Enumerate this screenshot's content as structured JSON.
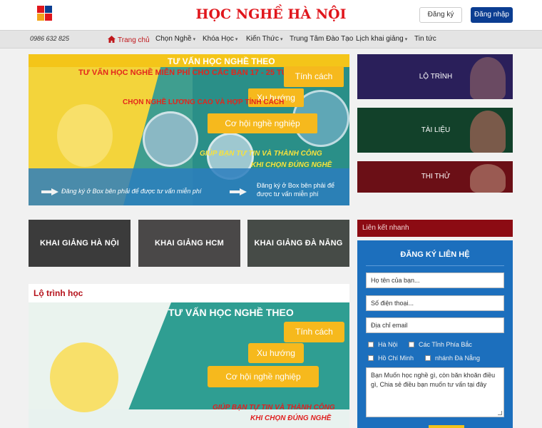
{
  "header": {
    "title": "HỌC NGHỀ HÀ NỘI",
    "register_label": "Đăng ký",
    "login_label": "Đăng nhập",
    "logo_colors": [
      "#e0161c",
      "#f3a51b",
      "#0b3d91",
      "#e0161c"
    ]
  },
  "nav": {
    "phone": "0986 632 825",
    "items": [
      {
        "label": "Trang chủ",
        "icon": "home-icon",
        "active": true
      },
      {
        "label": "Chọn Nghề",
        "dropdown": true
      },
      {
        "label": "Khóa Học",
        "dropdown": true
      },
      {
        "label": "Kiến Thức",
        "dropdown": true
      },
      {
        "label": "Trung Tâm Đào Tạo",
        "dropdown": false
      },
      {
        "label": "Lịch khai giảng",
        "dropdown": true
      },
      {
        "label": "Tin tức",
        "dropdown": false
      }
    ]
  },
  "hero": {
    "line1": "TƯ VẤN HỌC NGHỀ THEO",
    "line2": "TƯ VẤN HỌC NGHỀ MIỄN PHÍ CHO CÁC BẠN 17 - 25 TUỔI",
    "pills": [
      "Tính cách",
      "Xu hướng",
      "Cơ hội nghề nghiệp"
    ],
    "line3": "CHỌN NGHỀ LƯƠNG CAO VÀ HỢP TÍNH CÁCH",
    "slogan1": "GIÚP BẠN TỰ TIN VÀ THÀNH CÔNG",
    "slogan2": "KHI CHỌN ĐÚNG NGHỀ",
    "cta_left": "Đăng ký ở Box bên phải để được tư vấn miễn phí",
    "cta_right": "Đăng ký ở Box bên phải để được tư vấn miễn phí"
  },
  "side_tiles": [
    {
      "label": "LỘ TRÌNH",
      "color": "#2a1f5a"
    },
    {
      "label": "TÀI LIỆU",
      "color": "#12412a"
    },
    {
      "label": "THI THỬ",
      "color": "#6b0f16"
    }
  ],
  "khai_giang": [
    {
      "label": "KHAI GIẢNG HÀ NỘI"
    },
    {
      "label": "KHAI GIẢNG HCM"
    },
    {
      "label": "KHAI GIẢNG ĐÀ NẴNG"
    }
  ],
  "lo_trinh": {
    "title": "Lộ trình học",
    "line1": "TƯ VẤN HỌC NGHỀ THEO",
    "pills": [
      "Tính cách",
      "Xu hướng",
      "Cơ hội nghề nghiệp"
    ],
    "slogan1": "GIÚP BẠN TỰ TIN VÀ THÀNH CÔNG",
    "slogan2": "KHI CHỌN ĐÚNG NGHỀ"
  },
  "quick_links": {
    "label": "Liên kết nhanh"
  },
  "form": {
    "title": "ĐĂNG KÝ LIÊN HỆ",
    "name_placeholder": "Họ tên của bạn...",
    "phone_placeholder": "Số điện thoại...",
    "email_placeholder": "Địa chỉ email",
    "locations": [
      "Hà Nội",
      "Các Tỉnh Phía Bắc",
      "Hồ Chí Minh",
      "nhánh Đà Nẵng"
    ],
    "message": "Bạn Muốn học nghề gì, còn băn khoăn điều gì, Chia sẻ điều bạn muốn tư vấn tại đây"
  }
}
